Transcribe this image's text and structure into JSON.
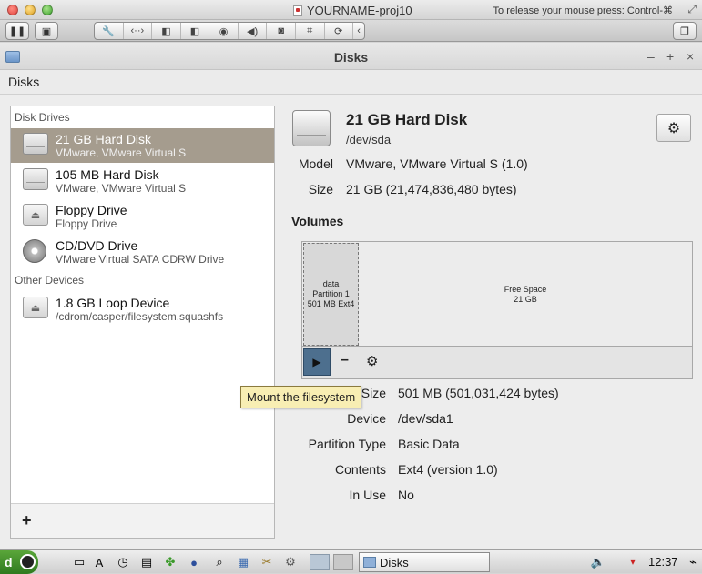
{
  "mac": {
    "title": "YOURNAME-proj10",
    "release_hint": "To release your mouse press: Control-⌘",
    "toolbar_icons": [
      "pause-icon",
      "settings-icon",
      "wrench-icon",
      "network-icon",
      "disk-icon",
      "disk-icon",
      "cd-icon",
      "speaker-icon",
      "camera-icon",
      "usb-icon",
      "sync-icon",
      "chevron-left-icon",
      "window-icon"
    ]
  },
  "window": {
    "title": "Disks",
    "minimize": "–",
    "maximize": "+",
    "close": "×"
  },
  "menubar": {
    "app_menu": "Disks"
  },
  "sidebar": {
    "drives_header": "Disk Drives",
    "drives": [
      {
        "name": "21 GB Hard Disk",
        "sub": "VMware, VMware Virtual S",
        "icon": "hard-disk-icon",
        "selected": true
      },
      {
        "name": "105 MB Hard Disk",
        "sub": "VMware, VMware Virtual S",
        "icon": "hard-disk-icon"
      },
      {
        "name": "Floppy Drive",
        "sub": "Floppy Drive",
        "icon": "eject-icon"
      },
      {
        "name": "CD/DVD Drive",
        "sub": "VMware Virtual SATA CDRW Drive",
        "icon": "optical-disc-icon"
      }
    ],
    "other_header": "Other Devices",
    "other": [
      {
        "name": "1.8 GB Loop Device",
        "sub": "/cdrom/casper/filesystem.squashfs",
        "icon": "eject-icon"
      }
    ],
    "add_button": "+"
  },
  "disk": {
    "title": "21 GB Hard Disk",
    "device": "/dev/sda",
    "model_label": "Model",
    "model_value": "VMware, VMware Virtual S (1.0)",
    "size_label": "Size",
    "size_value": "21 GB (21,474,836,480 bytes)"
  },
  "volumes": {
    "header_underlined": "V",
    "header_rest": "olumes",
    "partition": {
      "line1": "data",
      "line2": "Partition 1",
      "line3": "501 MB Ext4"
    },
    "free": {
      "line1": "Free Space",
      "line2": "21 GB"
    },
    "tooltip": "Mount the filesystem",
    "props": [
      {
        "label": "Size",
        "value": "501 MB (501,031,424 bytes)"
      },
      {
        "label": "Device",
        "value": "/dev/sda1"
      },
      {
        "label": "Partition Type",
        "value": "Basic Data"
      },
      {
        "label": "Contents",
        "value": "Ext4 (version 1.0)"
      },
      {
        "label": "In Use",
        "value": "No"
      }
    ]
  },
  "taskbar": {
    "start_label": "d",
    "window_button": "Disks",
    "clock": "12:37"
  }
}
